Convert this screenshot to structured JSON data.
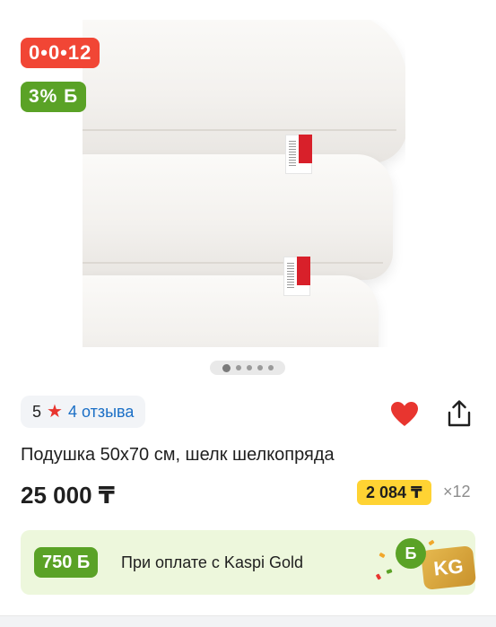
{
  "badges": {
    "timer": "0•0•12",
    "bonus": "3% Б"
  },
  "gallery": {
    "image_count": 5,
    "active_index": 0
  },
  "rating": {
    "score": "5",
    "star_icon": "★",
    "reviews": "4 отзыва"
  },
  "actions": {
    "favorite_icon": "heart-icon",
    "share_icon": "share-icon"
  },
  "product": {
    "title": "Подушка 50х70 см, шелк шелкопряда",
    "price": "25 000 ₸",
    "monthly_payment": "2 084 ₸",
    "installment_months": "×12"
  },
  "kaspi_gold": {
    "bonus": "750 Б",
    "label": "При оплате с Kaspi Gold",
    "coin": "Б",
    "card": "KG"
  },
  "colors": {
    "accent_red": "#f14635",
    "bonus_green": "#5aa226",
    "link_blue": "#1b6fc6",
    "monthly_yellow": "#ffd333"
  }
}
